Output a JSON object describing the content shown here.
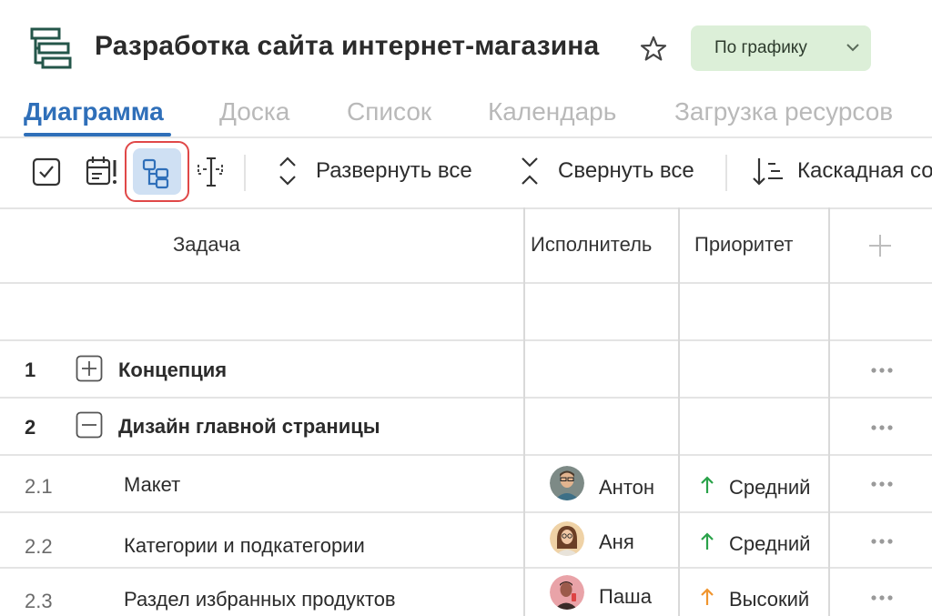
{
  "header": {
    "title": "Разработка сайта интернет-магазина",
    "status_label": "По графику",
    "icons": {
      "app": "gantt-project-icon",
      "favorite": "star-outline-icon",
      "status_dropdown": "chevron-down-icon"
    }
  },
  "tabs": [
    {
      "label": "Диаграмма",
      "active": true
    },
    {
      "label": "Доска",
      "active": false
    },
    {
      "label": "Список",
      "active": false
    },
    {
      "label": "Календарь",
      "active": false
    },
    {
      "label": "Загрузка ресурсов",
      "active": false
    }
  ],
  "toolbar": {
    "expand_all": "Развернуть все",
    "collapse_all": "Свернуть все",
    "cascade_sort": "Каскадная со",
    "icons": [
      "checkbox-icon",
      "calendar-alert-icon",
      "hierarchy-icon",
      "column-width-icon",
      "expand-vertical-icon",
      "collapse-vertical-icon",
      "sort-cascade-icon"
    ]
  },
  "table": {
    "headers": {
      "task": "Задача",
      "assignee": "Исполнитель",
      "priority": "Приоритет",
      "add": "+"
    },
    "rows": [
      {
        "num": "1",
        "task": "Концепция",
        "group": true,
        "expanded": false
      },
      {
        "num": "2",
        "task": "Дизайн главной страницы",
        "group": true,
        "expanded": true
      },
      {
        "num": "2.1",
        "task": "Макет",
        "assignee": "Антон",
        "priority": "Средний",
        "priority_color": "#2aa24a"
      },
      {
        "num": "2.2",
        "task": "Категории и подкатегории",
        "assignee": "Аня",
        "priority": "Средний",
        "priority_color": "#2aa24a"
      },
      {
        "num": "2.3",
        "task": "Раздел избранных продуктов",
        "assignee": "Паша",
        "priority": "Высокий",
        "priority_color": "#f0952e"
      }
    ]
  },
  "colors": {
    "accent": "#2f6fb9",
    "status_bg": "#dcefd8",
    "selected_tool_bg": "#cfe0f3",
    "highlight_border": "#e04848"
  }
}
